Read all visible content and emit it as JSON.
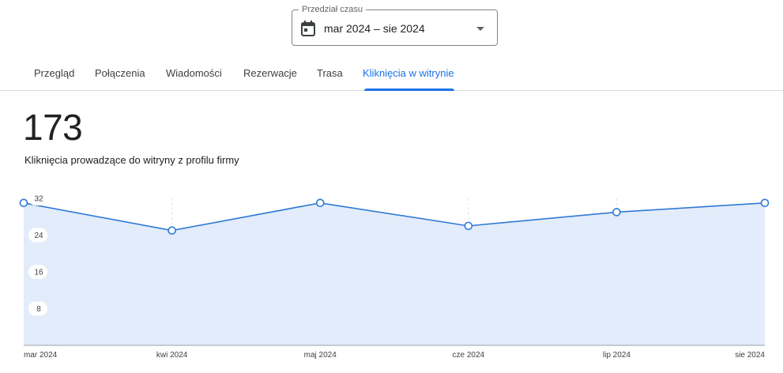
{
  "date_range": {
    "legend": "Przedział czasu",
    "value": "mar 2024 – sie 2024",
    "icon": "calendar-icon"
  },
  "tabs": [
    {
      "label": "Przegląd",
      "active": false
    },
    {
      "label": "Połączenia",
      "active": false
    },
    {
      "label": "Wiadomości",
      "active": false
    },
    {
      "label": "Rezerwacje",
      "active": false
    },
    {
      "label": "Trasa",
      "active": false
    },
    {
      "label": "Kliknięcia w witrynie",
      "active": true
    }
  ],
  "metric": {
    "total": "173",
    "label": "Kliknięcia prowadzące do witryny z profilu firmy"
  },
  "colors": {
    "accent": "#1a73e8",
    "line": "#2f7ad6",
    "area": "#e3ecfa"
  },
  "chart_data": {
    "type": "area",
    "categories": [
      "mar 2024",
      "kwi 2024",
      "maj 2024",
      "cze 2024",
      "lip 2024",
      "sie 2024"
    ],
    "values": [
      31,
      25,
      31,
      26,
      29,
      31
    ],
    "ylim": [
      0,
      32
    ],
    "yticks": [
      8,
      16,
      24,
      32
    ],
    "grid": "vertical-dashed",
    "legend": "none"
  }
}
